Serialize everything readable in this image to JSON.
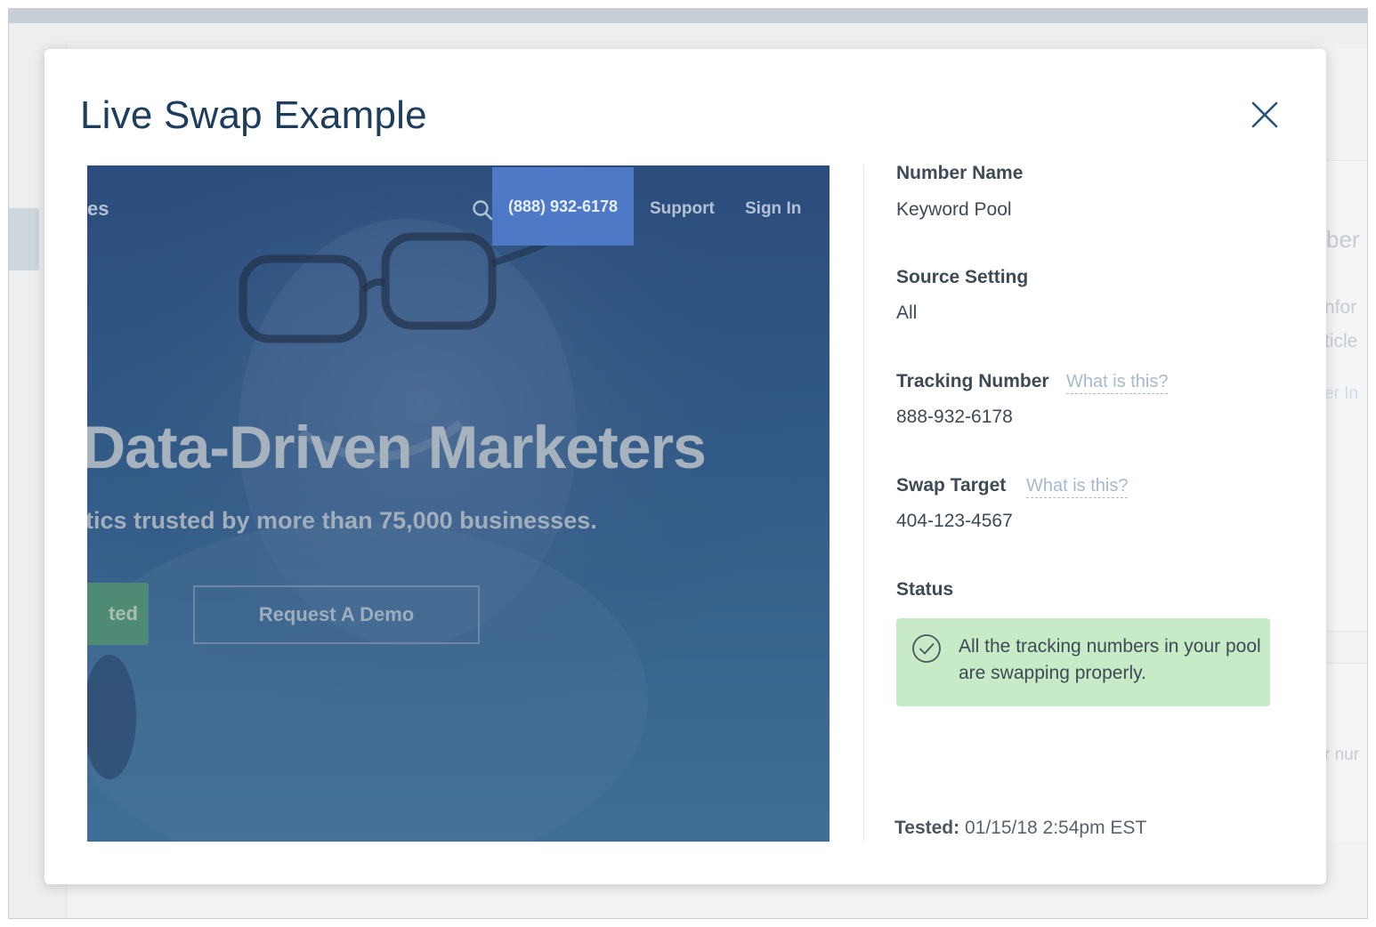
{
  "background": {
    "fragments": [
      "ber",
      "nfor",
      "ticle",
      "er In",
      "r nur"
    ]
  },
  "modal": {
    "title": "Live Swap Example",
    "close_icon": "close-icon"
  },
  "preview": {
    "nav_fragment": "es",
    "phone": "(888) 932-6178",
    "support": "Support",
    "sign_in": "Sign In",
    "headline": "Data-Driven Marketers",
    "subheadline": "tics trusted by more than 75,000 businesses.",
    "cta_fragment": "ted",
    "demo_button": "Request A Demo",
    "highlight_color": "#4d79c6"
  },
  "details": {
    "number_name": {
      "label": "Number Name",
      "value": "Keyword Pool"
    },
    "source_setting": {
      "label": "Source Setting",
      "value": "All"
    },
    "tracking_number": {
      "label": "Tracking Number",
      "help": "What is this?",
      "value": "888-932-6178"
    },
    "swap_target": {
      "label": "Swap Target",
      "help": "What is this?",
      "value": "404-123-4567"
    },
    "status": {
      "label": "Status",
      "message": "All the tracking numbers in your pool are swapping properly.",
      "icon": "check-circle-icon",
      "color": "#c7ebc6"
    },
    "tested": {
      "label": "Tested:",
      "value": "01/15/18 2:54pm EST"
    }
  }
}
